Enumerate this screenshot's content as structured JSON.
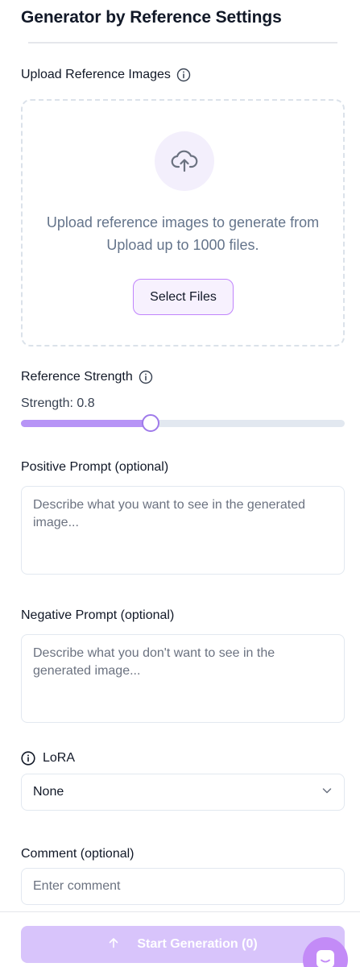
{
  "header": {
    "title": "Generator by Reference Settings"
  },
  "upload": {
    "label": "Upload Reference Images",
    "line1": "Upload reference images to generate from",
    "line2": "Upload up to 1000 files.",
    "button": "Select Files",
    "icon": "upload-cloud-icon"
  },
  "strength": {
    "label": "Reference Strength",
    "value_text": "Strength: 0.8",
    "value": 0.8,
    "min": 0,
    "max": 2
  },
  "positive": {
    "label": "Positive Prompt (optional)",
    "placeholder": "Describe what you want to see in the generated image...",
    "value": ""
  },
  "negative": {
    "label": "Negative Prompt (optional)",
    "placeholder": "Describe what you don't want to see in the generated image...",
    "value": ""
  },
  "lora": {
    "label": "LoRA",
    "selected": "None"
  },
  "comment": {
    "label": "Comment (optional)",
    "placeholder": "Enter comment",
    "value": ""
  },
  "footer": {
    "start_label": "Start Generation (0)",
    "start_icon": "arrow-up-icon"
  },
  "colors": {
    "accent": "#b794f6",
    "accent_border": "#c084fc",
    "button_disabled": "#d8c4fb",
    "chat_fab": "#c38bf7"
  }
}
